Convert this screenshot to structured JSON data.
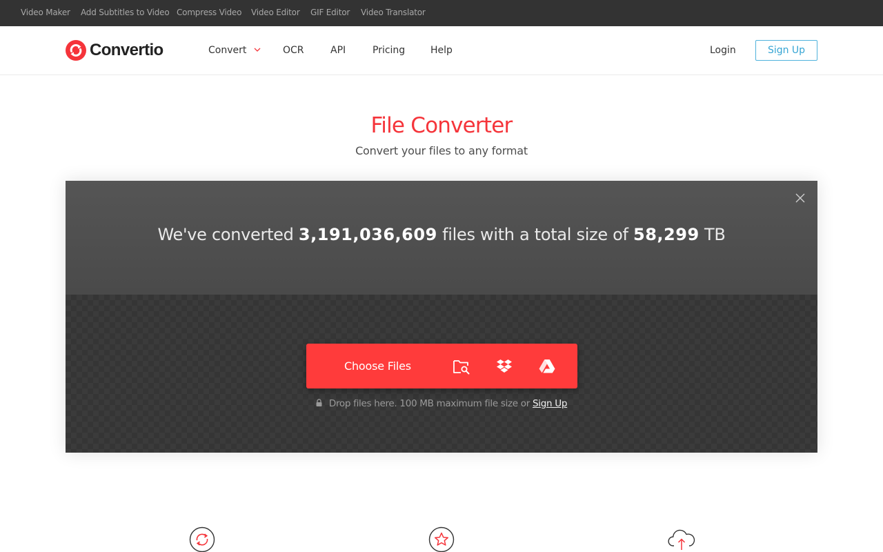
{
  "topbar": {
    "links": [
      "Video Maker",
      "Add Subtitles to Video",
      "Compress Video",
      "Video Editor",
      "GIF Editor",
      "Video Translator"
    ]
  },
  "header": {
    "logo_text": "Convertio",
    "nav": [
      "Convert",
      "OCR",
      "API",
      "Pricing",
      "Help"
    ],
    "login_label": "Login",
    "signup_label": "Sign Up"
  },
  "hero": {
    "title": "File Converter",
    "subtitle": "Convert your files to any format"
  },
  "stats": {
    "prefix": "We've converted",
    "files_count": "3,191,036,609",
    "middle": "files with a total size of",
    "total_size": "58,299",
    "unit": "TB"
  },
  "upload": {
    "choose_label": "Choose Files",
    "sources": [
      "folder-search-icon",
      "dropbox-icon",
      "google-drive-icon"
    ],
    "note_text": "Drop files here. 100 MB maximum file size or",
    "note_link": "Sign Up"
  },
  "features": {
    "icons": [
      "refresh-icon",
      "star-icon",
      "cloud-upload-icon"
    ]
  },
  "colors": {
    "accent": "#ff3b3b",
    "title_red": "#f5343a",
    "signup_blue": "#36a5d4",
    "topbar_bg": "#333333",
    "panel_bg": "#4a4a4a"
  }
}
